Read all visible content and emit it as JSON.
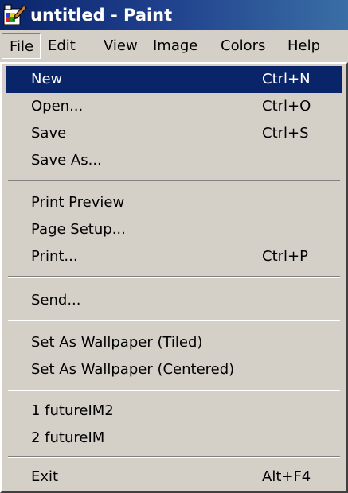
{
  "window": {
    "title": "untitled - Paint",
    "icon": "paint-app-icon"
  },
  "menubar": {
    "items": [
      "File",
      "Edit",
      "View",
      "Image",
      "Colors",
      "Help"
    ],
    "open_menu": "File"
  },
  "file_menu": {
    "highlighted": "New",
    "items": [
      {
        "label": "New",
        "shortcut": "Ctrl+N"
      },
      {
        "label": "Open...",
        "shortcut": "Ctrl+O"
      },
      {
        "label": "Save",
        "shortcut": "Ctrl+S"
      },
      {
        "label": "Save As...",
        "shortcut": ""
      },
      {
        "label": "Print Preview",
        "shortcut": ""
      },
      {
        "label": "Page Setup...",
        "shortcut": ""
      },
      {
        "label": "Print...",
        "shortcut": "Ctrl+P"
      },
      {
        "label": "Send...",
        "shortcut": ""
      },
      {
        "label": "Set As Wallpaper (Tiled)",
        "shortcut": ""
      },
      {
        "label": "Set As Wallpaper (Centered)",
        "shortcut": ""
      },
      {
        "label": "1 futureIM2",
        "shortcut": ""
      },
      {
        "label": "2 futureIM",
        "shortcut": ""
      },
      {
        "label": "Exit",
        "shortcut": "Alt+F4"
      }
    ]
  },
  "colors": {
    "titlebar_start": "#0a246a",
    "titlebar_end": "#3a6ea5",
    "highlight": "#0a246a",
    "face": "#d4d0c8"
  }
}
